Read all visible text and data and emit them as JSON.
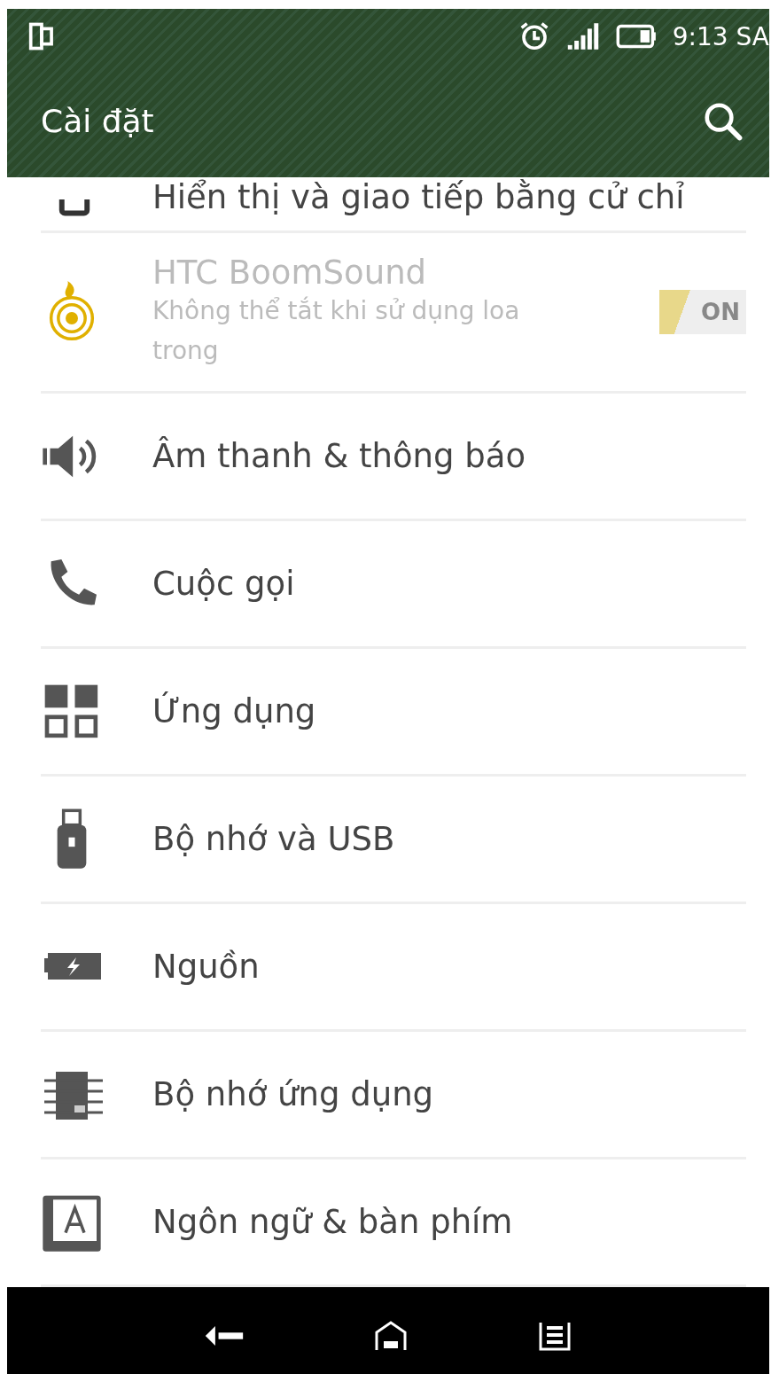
{
  "status_bar": {
    "time": "9:13 SA"
  },
  "header": {
    "title": "Cài đặt"
  },
  "settings": [
    {
      "kind": "setting",
      "label": "Hiển thị và giao tiếp bằng cử chỉ",
      "disabled": false,
      "partial": true
    },
    {
      "kind": "toggle",
      "label": "HTC BoomSound",
      "subtitle": "Không thể tắt khi sử dụng loa trong",
      "disabled": true,
      "toggle": {
        "on": true,
        "label": "ON"
      }
    },
    {
      "kind": "setting",
      "label": "Âm thanh & thông báo",
      "disabled": false
    },
    {
      "kind": "setting",
      "label": "Cuộc gọi",
      "disabled": false
    },
    {
      "kind": "setting",
      "label": "Ứng dụng",
      "disabled": false
    },
    {
      "kind": "setting",
      "label": "Bộ nhớ và USB",
      "disabled": false
    },
    {
      "kind": "setting",
      "label": "Nguồn",
      "disabled": false
    },
    {
      "kind": "setting",
      "label": "Bộ nhớ ứng dụng",
      "disabled": false
    },
    {
      "kind": "setting",
      "label": "Ngôn ngữ & bàn phím",
      "disabled": false
    }
  ]
}
